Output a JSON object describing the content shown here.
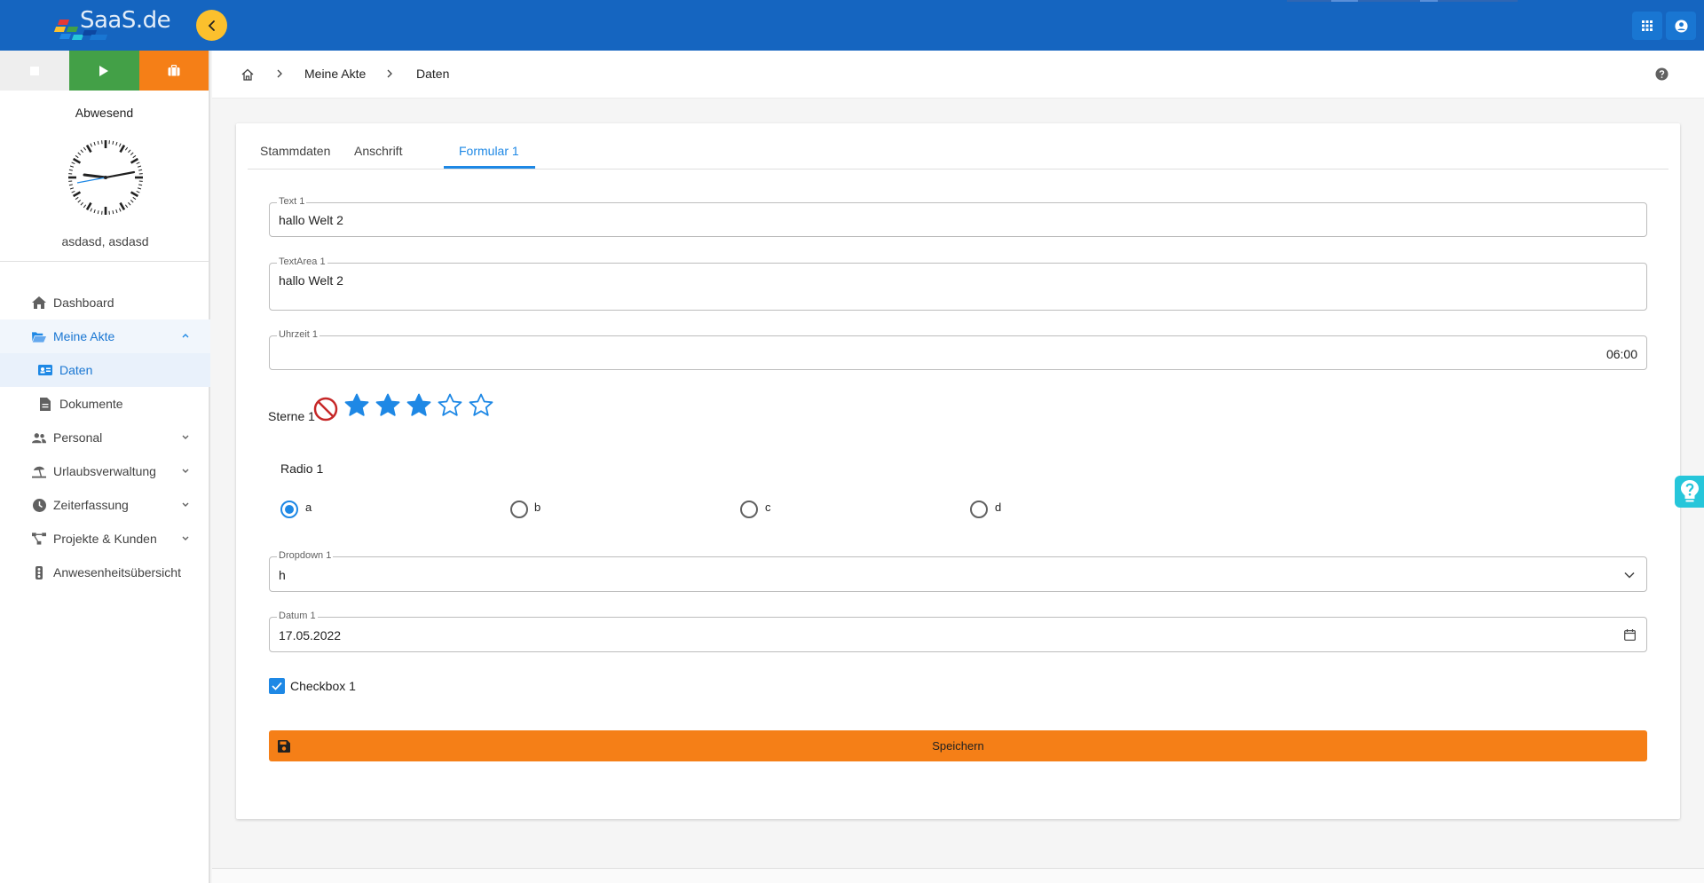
{
  "header": {
    "logo_text": "SaaS.de",
    "toggle_icon": "chevron-left-icon",
    "apps_icon": "grid-icon",
    "account_icon": "account-circle-icon",
    "colors": {
      "primary": "#1565c0",
      "toggle": "#fbc02d"
    }
  },
  "sidebar": {
    "status_buttons": [
      {
        "name": "stop",
        "icon": "stop-icon",
        "color": "#eeeeee"
      },
      {
        "name": "play",
        "icon": "play-icon",
        "color": "#43a047"
      },
      {
        "name": "pause",
        "icon": "briefcase-icon",
        "color": "#f57f17"
      }
    ],
    "status_label": "Abwesend",
    "user_name": "asdasd, asdasd",
    "items": [
      {
        "label": "Dashboard",
        "icon": "home-icon"
      },
      {
        "label": "Meine Akte",
        "icon": "folder-open-icon",
        "expanded": true
      },
      {
        "label": "Daten",
        "icon": "id-card-icon",
        "active": true
      },
      {
        "label": "Dokumente",
        "icon": "file-icon"
      },
      {
        "label": "Personal",
        "icon": "users-icon"
      },
      {
        "label": "Urlaubsverwaltung",
        "icon": "beach-umbrella-icon"
      },
      {
        "label": "Zeiterfassung",
        "icon": "clock-icon"
      },
      {
        "label": "Projekte & Kunden",
        "icon": "project-diagram-icon"
      },
      {
        "label": "Anwesenheitsübersicht",
        "icon": "traffic-light-icon"
      }
    ]
  },
  "breadcrumb": {
    "home_icon": "home-outline-icon",
    "items": [
      "Meine Akte",
      "Daten"
    ],
    "help_icon": "help-circle-icon"
  },
  "tabs": [
    {
      "label": "Stammdaten"
    },
    {
      "label": "Anschrift"
    },
    {
      "label": "Formular 1",
      "active": true
    }
  ],
  "form": {
    "text1": {
      "label": "Text 1",
      "value": "hallo Welt 2"
    },
    "textarea1": {
      "label": "TextArea 1",
      "value": "hallo Welt 2"
    },
    "time1": {
      "label": "Uhrzeit 1",
      "value": "06:00"
    },
    "stars1": {
      "label": "Sterne 1",
      "value": 3,
      "max": 5
    },
    "radio1": {
      "label": "Radio 1",
      "options": [
        "a",
        "b",
        "c",
        "d"
      ],
      "selected": "a"
    },
    "dropdown1": {
      "label": "Dropdown 1",
      "value": "h"
    },
    "date1": {
      "label": "Datum 1",
      "value": "17.05.2022"
    },
    "checkbox1": {
      "label": "Checkbox 1",
      "checked": true
    },
    "save_label": "Speichern",
    "save_color": "#f57f17"
  }
}
